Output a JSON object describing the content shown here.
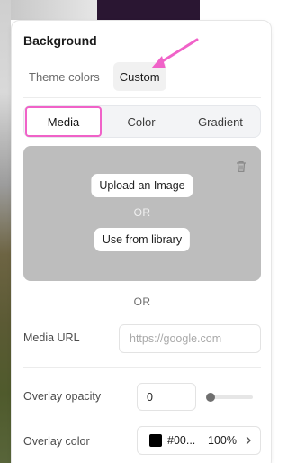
{
  "panel": {
    "title": "Background",
    "mode_tabs": [
      {
        "label": "Theme colors",
        "active": false
      },
      {
        "label": "Custom",
        "active": true
      }
    ],
    "type_tabs": [
      {
        "label": "Media",
        "active": true
      },
      {
        "label": "Color",
        "active": false
      },
      {
        "label": "Gradient",
        "active": false
      }
    ]
  },
  "media": {
    "upload_label": "Upload an Image",
    "or_label": "OR",
    "library_label": "Use from library",
    "delete_icon": "trash-icon"
  },
  "separator_or": "OR",
  "media_url": {
    "label": "Media URL",
    "value": "",
    "placeholder": "https://google.com"
  },
  "overlay_opacity": {
    "label": "Overlay opacity",
    "value": "0",
    "slider_value": 0
  },
  "overlay_color": {
    "label": "Overlay color",
    "hex": "#00...",
    "percent": "100%",
    "swatch_color": "#000000",
    "chevron_icon": "chevron-right-icon"
  },
  "colors": {
    "highlight": "#f062c8",
    "media_box": "#bdbdbd"
  }
}
